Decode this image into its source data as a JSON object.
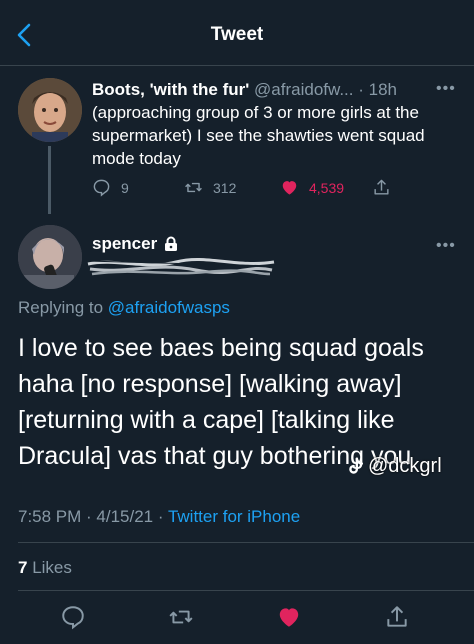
{
  "header": {
    "title": "Tweet"
  },
  "parent_tweet": {
    "name": "Boots, 'with the fur'",
    "handle": "@afraidofw...",
    "time": "· 18h",
    "text": "(approaching group of 3 or more girls at the supermarket) I see the shawties went squad mode today",
    "replies": "9",
    "retweets": "312",
    "likes": "4,539"
  },
  "main_tweet": {
    "name": "spencer",
    "replying_prefix": "Replying to ",
    "replying_to": "@afraidofwasps",
    "text": "I love to see baes being squad goals haha [no response] [walking away] [returning with a cape] [talking like Dracula] vas that guy bothering you",
    "date": "7:58 PM · 4/15/21 · ",
    "source": "Twitter for iPhone",
    "likes_count": "7",
    "likes_label": " Likes"
  },
  "watermark": {
    "text": "@dckgrl"
  },
  "colors": {
    "background": "#15202b",
    "accent": "#1da1f2",
    "like": "#e0245e",
    "muted": "#8899a6",
    "divider": "#38444d"
  },
  "icons": [
    "back-arrow-icon",
    "more-icon",
    "reply-icon",
    "retweet-icon",
    "heart-icon",
    "share-icon",
    "lock-icon",
    "tiktok-icon"
  ]
}
